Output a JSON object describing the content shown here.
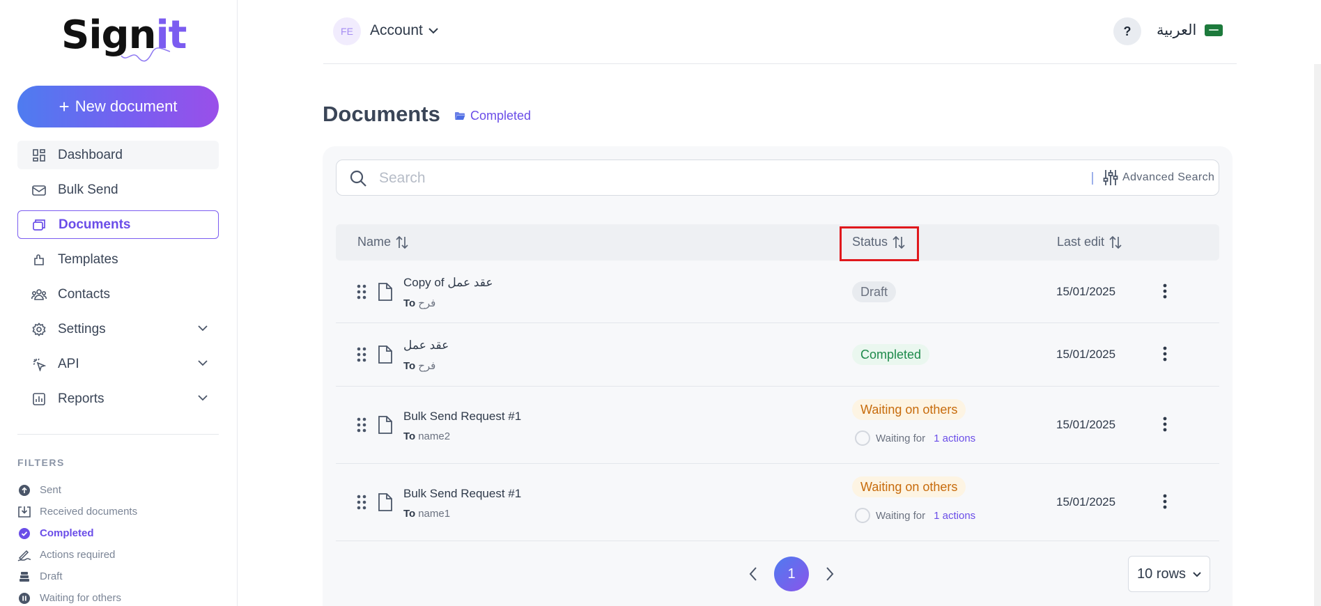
{
  "brand": {
    "logo_main": "Sign",
    "logo_accent": "it"
  },
  "sidebar": {
    "new_document": "New document",
    "items": [
      {
        "label": "Dashboard",
        "icon": "dashboard-icon"
      },
      {
        "label": "Bulk Send",
        "icon": "mail-icon"
      },
      {
        "label": "Documents",
        "icon": "folder-icon"
      },
      {
        "label": "Templates",
        "icon": "template-icon"
      },
      {
        "label": "Contacts",
        "icon": "contacts-icon"
      },
      {
        "label": "Settings",
        "icon": "gear-icon"
      },
      {
        "label": "API",
        "icon": "api-icon"
      },
      {
        "label": "Reports",
        "icon": "reports-icon"
      }
    ],
    "filters_title": "FILTERS",
    "filters": [
      {
        "label": "Sent"
      },
      {
        "label": "Received documents"
      },
      {
        "label": "Completed"
      },
      {
        "label": "Actions required"
      },
      {
        "label": "Draft"
      },
      {
        "label": "Waiting for others"
      }
    ]
  },
  "header": {
    "avatar_initials": "FE",
    "account_label": "Account",
    "help_label": "?",
    "language_label": "العربية"
  },
  "main": {
    "title": "Documents",
    "crumb": "Completed",
    "search": {
      "placeholder": "Search",
      "advanced_label": "Advanced Search"
    },
    "columns": {
      "name": "Name",
      "status": "Status",
      "last_edit": "Last edit"
    },
    "rows": [
      {
        "title": "Copy of عقد عمل",
        "to_label": "To",
        "to_value": "فرح",
        "status": "Draft",
        "waiting_label": "",
        "waiting_link": "",
        "date": "15/01/2025"
      },
      {
        "title": "عقد عمل",
        "to_label": "To",
        "to_value": "فرح",
        "status": "Completed",
        "waiting_label": "",
        "waiting_link": "",
        "date": "15/01/2025"
      },
      {
        "title": "Bulk Send Request #1",
        "to_label": "To",
        "to_value": "name2",
        "status": "Waiting on others",
        "waiting_label": "Waiting for",
        "waiting_link": "1 actions",
        "date": "15/01/2025"
      },
      {
        "title": "Bulk Send Request #1",
        "to_label": "To",
        "to_value": "name1",
        "status": "Waiting on others",
        "waiting_label": "Waiting for",
        "waiting_link": "1 actions",
        "date": "15/01/2025"
      }
    ],
    "pagination": {
      "current_page": "1",
      "rows_per_page": "10 rows"
    }
  },
  "colors": {
    "accent": "#6a4de8",
    "highlight_box": "#e0181c",
    "draft": "#6b7280",
    "completed": "#1e8a4b",
    "waiting": "#c76b0c"
  }
}
